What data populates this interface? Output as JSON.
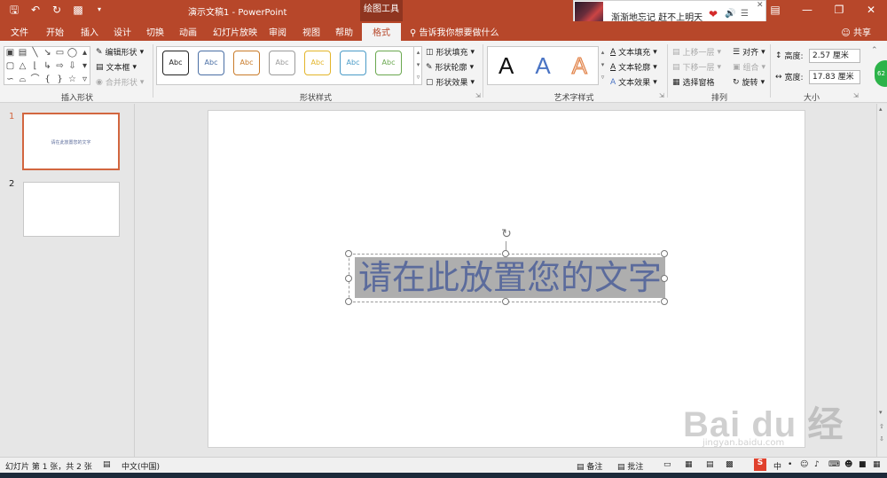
{
  "titlebar": {
    "quick_access": [
      "save-icon",
      "undo-icon",
      "redo-icon",
      "start-from-beginning-icon",
      "customize-icon"
    ],
    "doc_title": "演示文稿1 - PowerPoint",
    "contextual_tab": "绘图工具",
    "window_controls": [
      "ribbon-display-icon",
      "minimize-icon",
      "restore-icon",
      "close-icon"
    ]
  },
  "music_popup": {
    "song": "渐渐地忘记 赶不上明天"
  },
  "tabs": {
    "items": [
      "文件",
      "开始",
      "插入",
      "设计",
      "切换",
      "动画",
      "幻灯片放映",
      "审阅",
      "视图",
      "帮助"
    ],
    "active": "格式",
    "tell_me": "告诉我你想要做什么",
    "share": "共享"
  },
  "ribbon": {
    "insert_shapes": {
      "label": "插入形状",
      "edit_shape": "编辑形状",
      "text_box": "文本框",
      "merge_shapes": "合并形状"
    },
    "shape_styles": {
      "label": "形状样式",
      "swatch_text": "Abc",
      "swatch_colors": [
        "#222222",
        "#4a6fa5",
        "#c97b2a",
        "#9a9a9a",
        "#e3b52a",
        "#4a9bc7",
        "#6aa84f"
      ],
      "fill": "形状填充",
      "outline": "形状轮廓",
      "effects": "形状效果"
    },
    "wordart": {
      "label": "艺术字样式",
      "letter": "A",
      "text_fill": "文本填充",
      "text_outline": "文本轮廓",
      "text_effects": "文本效果"
    },
    "arrange": {
      "label": "排列",
      "bring_forward": "上移一层",
      "send_backward": "下移一层",
      "selection_pane": "选择窗格",
      "align": "对齐",
      "group": "组合",
      "rotate": "旋转"
    },
    "size": {
      "label": "大小",
      "height_label": "高度:",
      "height_value": "2.57 厘米",
      "width_label": "宽度:",
      "width_value": "17.83 厘米"
    },
    "badge": "62"
  },
  "slides": {
    "numbers": [
      "1",
      "2"
    ],
    "slide1_thumb_text": "请在此放置您的文字"
  },
  "canvas": {
    "textbox_text": "请在此放置您的文字"
  },
  "watermark": {
    "logo": "Bai du 经验",
    "url": "jingyan.baidu.com"
  },
  "status": {
    "slide_info": "幻灯片 第 1 张，共 2 张",
    "language": "中文(中国)",
    "notes": "备注",
    "comments": "批注"
  }
}
